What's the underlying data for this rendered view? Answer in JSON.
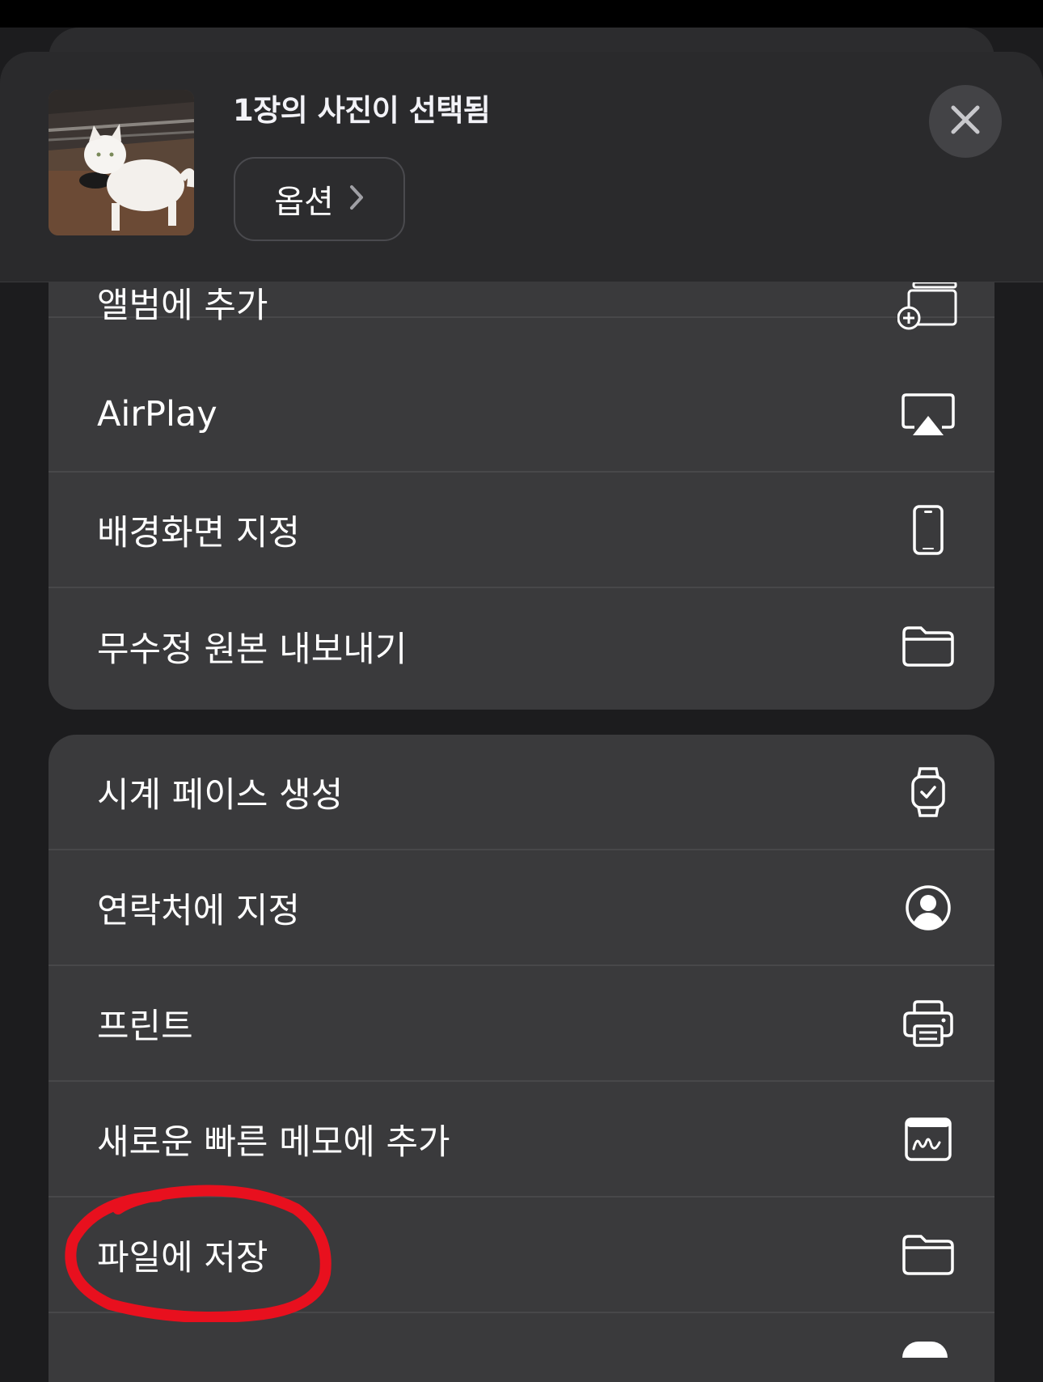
{
  "header": {
    "title": "1장의 사진이 선택됨",
    "options_label": "옵션",
    "thumbnail": "cat-photo-thumbnail"
  },
  "group1": {
    "items": [
      {
        "label": "앨범에 추가",
        "icon": "add-to-album-icon"
      },
      {
        "label": "AirPlay",
        "icon": "airplay-icon"
      },
      {
        "label": "배경화면 지정",
        "icon": "iphone-icon"
      },
      {
        "label": "무수정 원본 내보내기",
        "icon": "folder-icon"
      }
    ]
  },
  "group2": {
    "items": [
      {
        "label": "시계 페이스 생성",
        "icon": "watch-icon"
      },
      {
        "label": "연락처에 지정",
        "icon": "person-circle-icon"
      },
      {
        "label": "프린트",
        "icon": "printer-icon"
      },
      {
        "label": "새로운 빠른 메모에 추가",
        "icon": "quick-note-icon"
      },
      {
        "label": "파일에 저장",
        "icon": "folder-icon"
      }
    ]
  },
  "colors": {
    "background": "#1c1c1e",
    "card": "#3a3a3c",
    "header": "#2a2a2c",
    "annotation": "#e8101e"
  }
}
